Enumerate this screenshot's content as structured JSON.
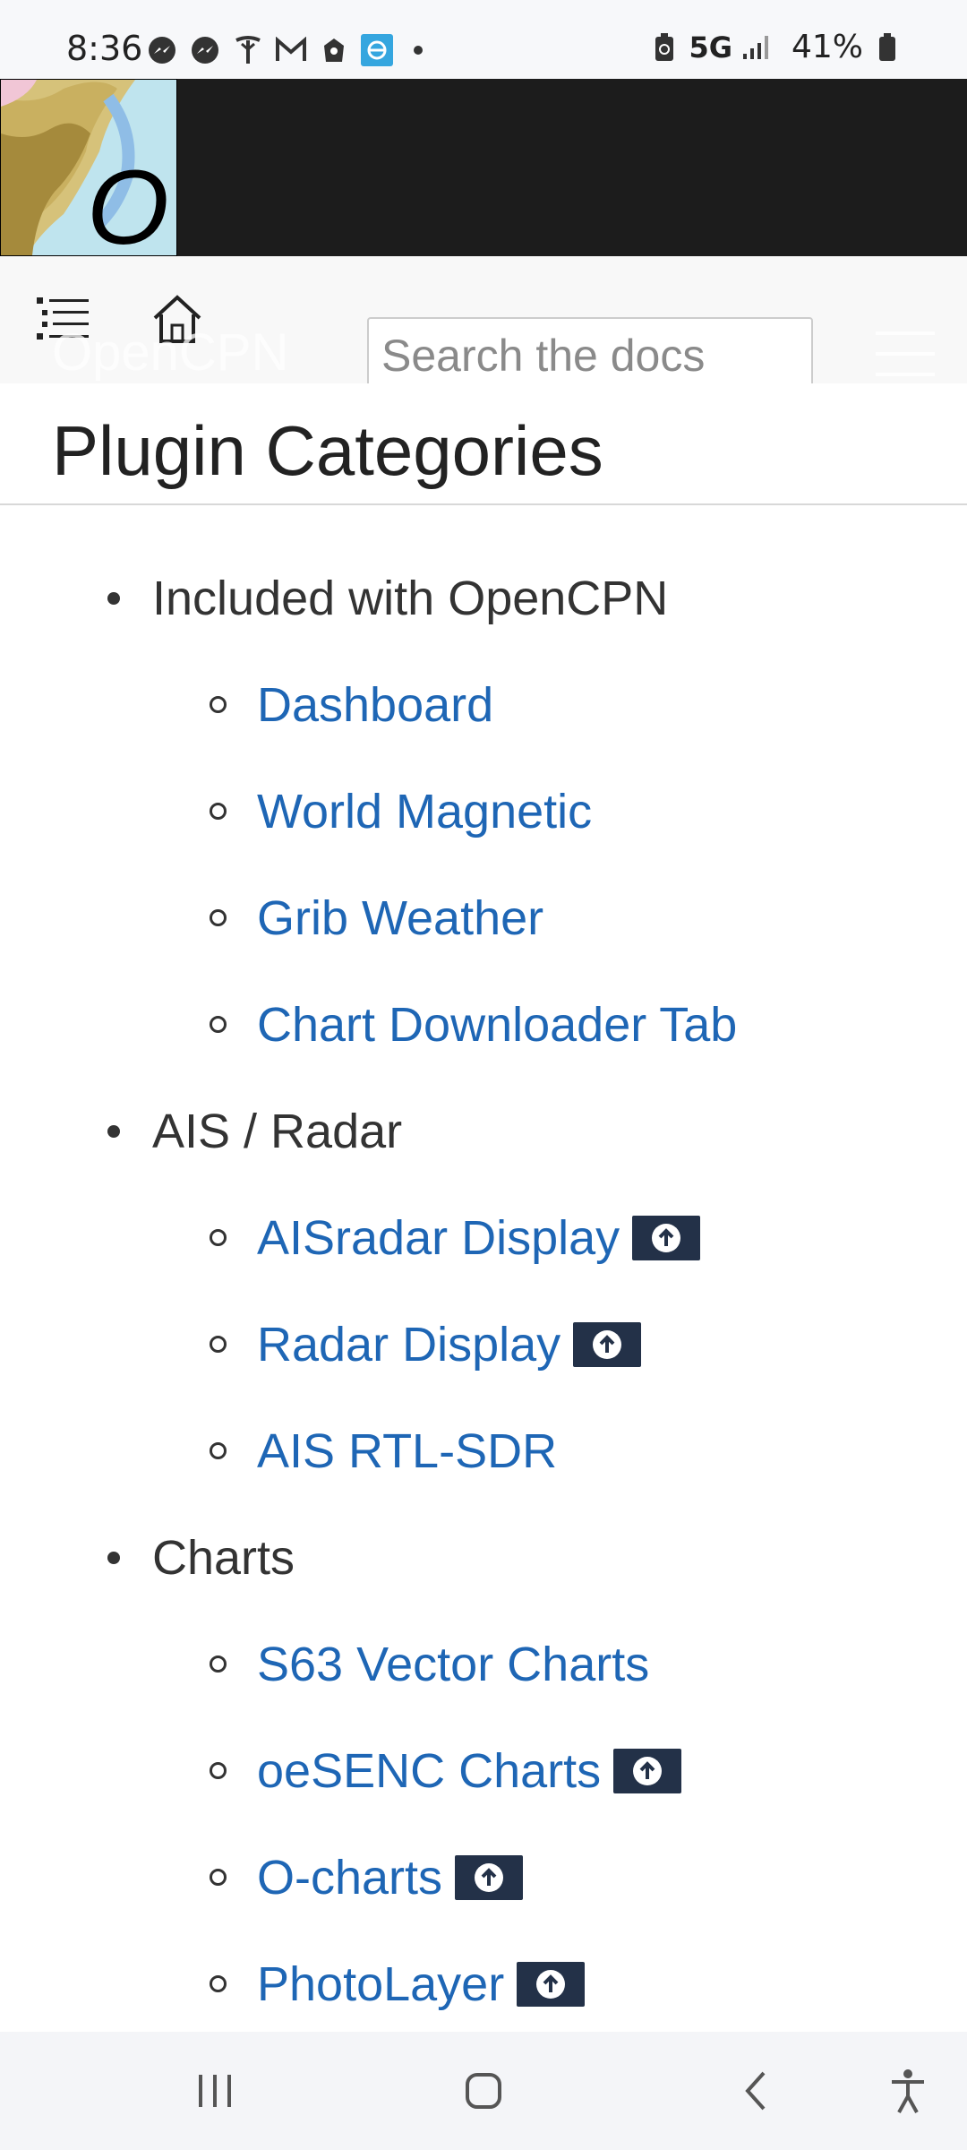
{
  "status_bar": {
    "time": "8:36",
    "network": "5G",
    "battery": "41%",
    "icons": [
      "messenger-icon",
      "messenger-icon",
      "antenna-icon",
      "gmail-icon",
      "app-icon",
      "browser-icon"
    ]
  },
  "banner": {
    "logo_letter": "O"
  },
  "nav": {
    "brand": "OpenCPN",
    "search_placeholder": "Search the docs"
  },
  "page": {
    "title": "Plugin Categories"
  },
  "categories": [
    {
      "label": "Included with OpenCPN",
      "items": [
        {
          "label": "Dashboard",
          "badge": false
        },
        {
          "label": "World Magnetic",
          "badge": false
        },
        {
          "label": "Grib Weather",
          "badge": false
        },
        {
          "label": "Chart Downloader Tab",
          "badge": false
        }
      ]
    },
    {
      "label": "AIS / Radar",
      "items": [
        {
          "label": "AISradar Display",
          "badge": true
        },
        {
          "label": "Radar Display",
          "badge": true
        },
        {
          "label": "AIS RTL-SDR",
          "badge": false
        }
      ]
    },
    {
      "label": "Charts",
      "items": [
        {
          "label": "S63 Vector Charts",
          "badge": false
        },
        {
          "label": "oeSENC Charts",
          "badge": true
        },
        {
          "label": "O-charts",
          "badge": true
        },
        {
          "label": "PhotoLayer",
          "badge": true
        }
      ]
    }
  ],
  "colors": {
    "link": "#1e66b5",
    "banner": "#1c1c1c",
    "badge": "#233148"
  }
}
